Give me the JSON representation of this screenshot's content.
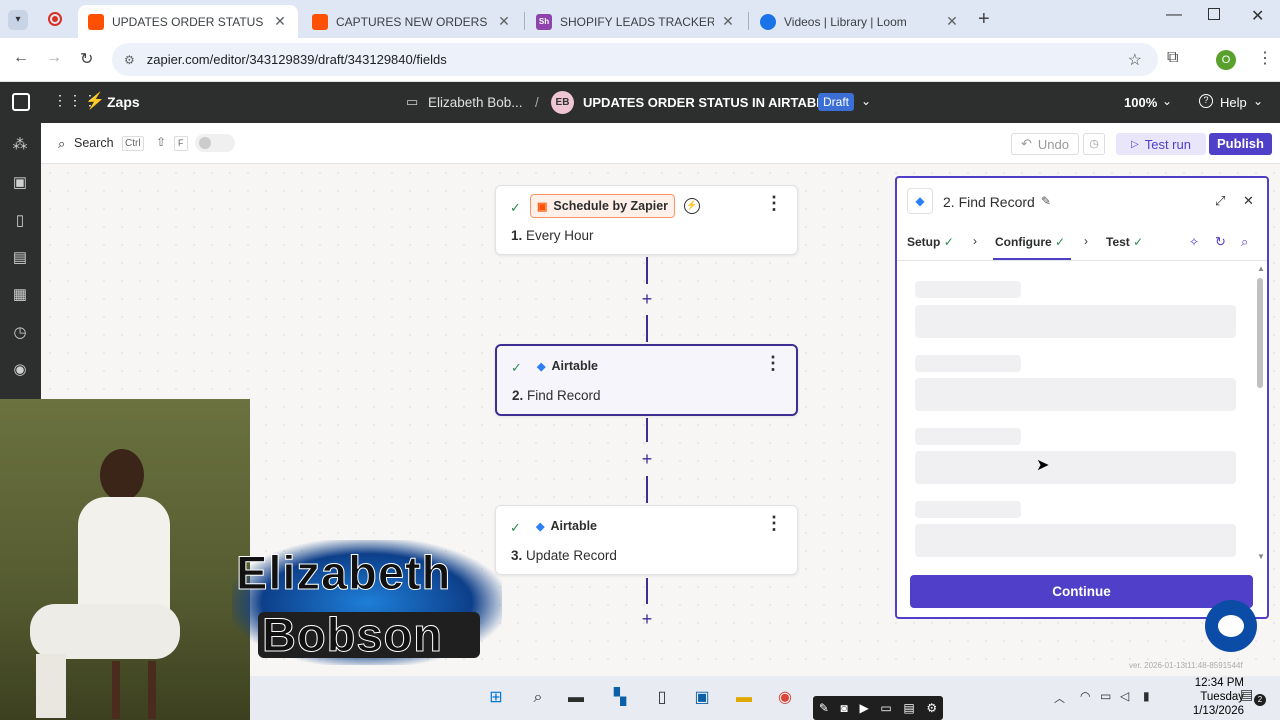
{
  "browser": {
    "tabs": [
      {
        "title": "UPDATES ORDER STATUS IN AIRTABLE",
        "favicon": "zapier-favicon",
        "color": "#ff4f00",
        "active": true
      },
      {
        "title": "CAPTURES NEW ORDERS IN AIRTABLE",
        "favicon": "zapier-favicon",
        "color": "#ff4f00",
        "active": false
      },
      {
        "title": "SHOPIFY LEADS TRACKER BY ELIZABETH",
        "favicon_text": "Sh",
        "color": "#8e44ad",
        "active": false
      },
      {
        "title": "Videos | Library | Loom",
        "favicon": "loom-favicon",
        "color": "#1a73e8",
        "active": false
      }
    ],
    "url": "zapier.com/editor/343129839/draft/343129840/fields",
    "profile_initial": "O"
  },
  "zapier_header": {
    "zaps_label": "Zaps",
    "folder": "Elizabeth Bob...",
    "separator": "/",
    "avatar_initials": "EB",
    "zap_name": "UPDATES ORDER STATUS IN AIRTABLE",
    "status_badge": "Draft",
    "zoom": "100%",
    "help": "Help"
  },
  "toolbar": {
    "search_label": "Search",
    "shortcut_ctrl": "Ctrl",
    "shortcut_shift": "⇧",
    "shortcut_f": "F",
    "undo": "Undo",
    "test_run": "Test run",
    "publish": "Publish"
  },
  "steps": [
    {
      "app": "Schedule by Zapier",
      "number": "1.",
      "title": "Every Hour"
    },
    {
      "app": "Airtable",
      "number": "2.",
      "title": "Find Record"
    },
    {
      "app": "Airtable",
      "number": "3.",
      "title": "Update Record"
    }
  ],
  "panel": {
    "title": "2. Find Record",
    "tabs": [
      {
        "label": "Setup"
      },
      {
        "label": "Configure"
      },
      {
        "label": "Test"
      }
    ],
    "continue": "Continue"
  },
  "version": "ver. 2026-01-13t11:48-8591544f",
  "overlay": {
    "name_line1": "Elizabeth",
    "name_line2": "Bobson"
  },
  "taskbar": {
    "time": "12:34 PM",
    "day": "Tuesday",
    "date": "1/13/2026",
    "notification_count": "2"
  },
  "colors": {
    "zapier_dark": "#2d2e2e",
    "accent": "#503fc9",
    "connector": "#3d2e94",
    "orange": "#ff4f00"
  }
}
